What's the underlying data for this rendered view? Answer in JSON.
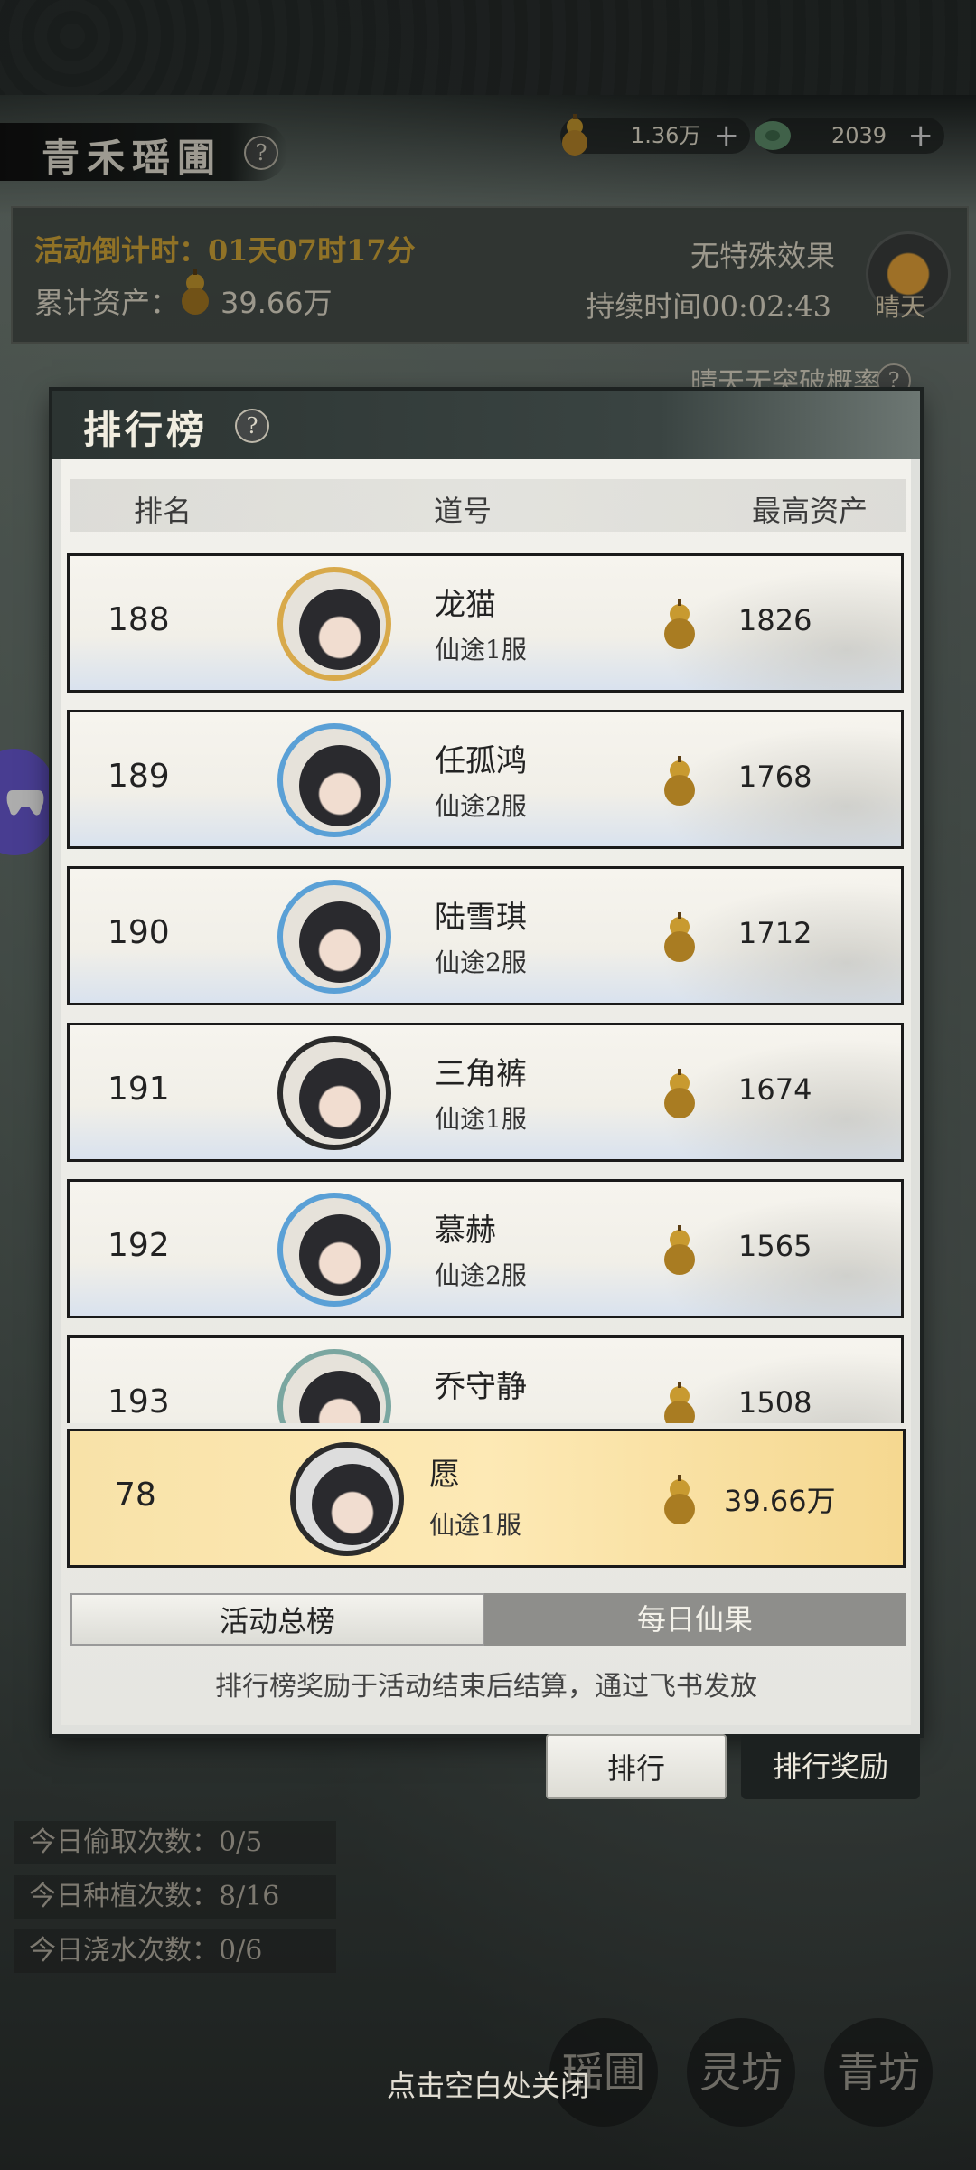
{
  "header": {
    "title": "青禾瑶圃",
    "currency1": "1.36万",
    "currency2": "2039"
  },
  "info": {
    "countdown": "活动倒计时：01天07时17分",
    "assets_label": "累计资产：",
    "assets_value": "39.66万",
    "effect": "无特殊效果",
    "duration": "持续时间00:02:43",
    "weather": "晴天",
    "weather_note": "晴天无突破概率"
  },
  "leaderboard": {
    "title": "排行榜",
    "columns": [
      "排名",
      "道号",
      "最高资产"
    ],
    "rows": [
      {
        "rank": "188",
        "name": "龙猫",
        "title": "仙途1服",
        "value": "1826"
      },
      {
        "rank": "189",
        "name": "任孤鸿",
        "title": "仙途2服",
        "value": "1768"
      },
      {
        "rank": "190",
        "name": "陆雪琪",
        "title": "仙途2服",
        "value": "1712"
      },
      {
        "rank": "191",
        "name": "三角裤",
        "title": "仙途1服",
        "value": "1674"
      },
      {
        "rank": "192",
        "name": "慕赫",
        "title": "仙途2服",
        "value": "1565"
      },
      {
        "rank": "193",
        "name": "乔守静",
        "title": "",
        "value": "1508"
      }
    ],
    "me": {
      "rank": "78",
      "name": "愿",
      "title": "仙途1服",
      "value": "39.66万"
    },
    "tabs": [
      "活动总榜",
      "每日仙果"
    ],
    "note": "排行榜奖励于活动结束后结算，通过飞书发放"
  },
  "buttons": {
    "rank": "排行",
    "reward": "排行奖励"
  },
  "counters": [
    "今日偷取次数：0/5",
    "今日种植次数：8/16",
    "今日浇水次数：0/6"
  ],
  "dock": [
    "瑶圃",
    "灵坊",
    "青坊"
  ],
  "close_hint": "点击空白处关闭",
  "colors": {
    "accent_gold": "#d4a838",
    "my_row": "#fde9b5"
  }
}
